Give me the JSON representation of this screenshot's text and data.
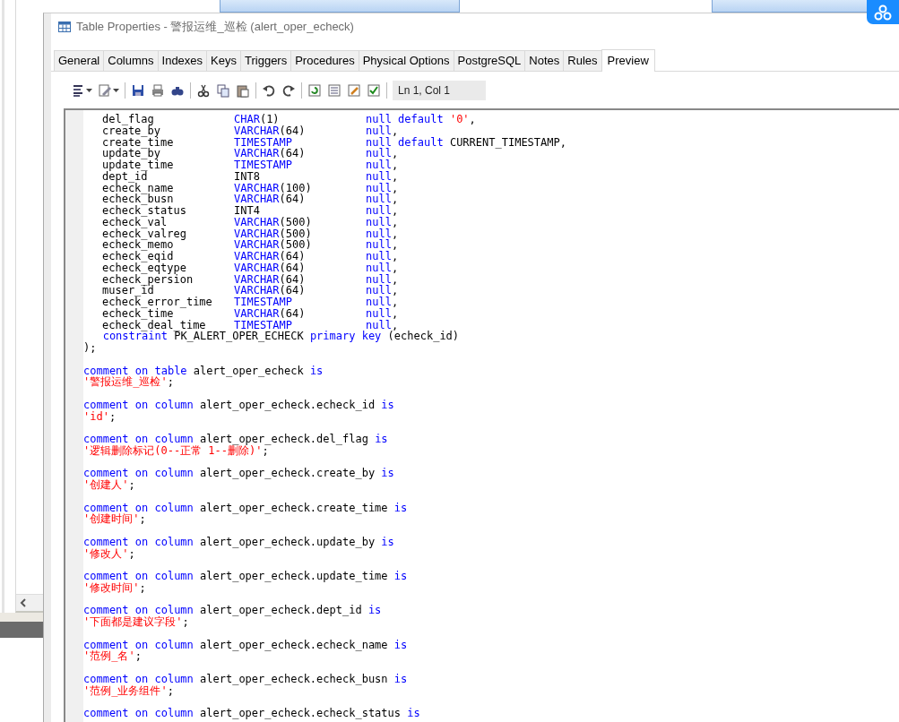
{
  "window": {
    "title": "Table Properties - 警报运维_巡检 (alert_oper_echeck)"
  },
  "tabs": [
    {
      "label": "General",
      "selected": false
    },
    {
      "label": "Columns",
      "selected": false
    },
    {
      "label": "Indexes",
      "selected": false
    },
    {
      "label": "Keys",
      "selected": false
    },
    {
      "label": "Triggers",
      "selected": false
    },
    {
      "label": "Procedures",
      "selected": false
    },
    {
      "label": "Physical Options",
      "selected": false
    },
    {
      "label": "PostgreSQL",
      "selected": false
    },
    {
      "label": "Notes",
      "selected": false
    },
    {
      "label": "Rules",
      "selected": false
    },
    {
      "label": "Preview",
      "selected": true
    }
  ],
  "toolbar": {
    "position": "Ln 1, Col 1"
  },
  "editor": {
    "columns": [
      {
        "name": "del_flag",
        "type": [
          {
            "kind": "keyword",
            "text": "CHAR"
          },
          {
            "kind": "plain",
            "text": "(1)"
          }
        ],
        "rest": [
          {
            "kind": "keyword",
            "text": "null default "
          },
          {
            "kind": "string",
            "text": "'0'"
          },
          {
            "kind": "plain",
            "text": ","
          }
        ]
      },
      {
        "name": "create_by",
        "type": [
          {
            "kind": "keyword",
            "text": "VARCHAR"
          },
          {
            "kind": "plain",
            "text": "(64)"
          }
        ],
        "rest": [
          {
            "kind": "keyword",
            "text": "null"
          },
          {
            "kind": "plain",
            "text": ","
          }
        ]
      },
      {
        "name": "create_time",
        "type": [
          {
            "kind": "keyword",
            "text": "TIMESTAMP"
          }
        ],
        "rest": [
          {
            "kind": "keyword",
            "text": "null default "
          },
          {
            "kind": "plain",
            "text": "CURRENT_TIMESTAMP,"
          }
        ]
      },
      {
        "name": "update_by",
        "type": [
          {
            "kind": "keyword",
            "text": "VARCHAR"
          },
          {
            "kind": "plain",
            "text": "(64)"
          }
        ],
        "rest": [
          {
            "kind": "keyword",
            "text": "null"
          },
          {
            "kind": "plain",
            "text": ","
          }
        ]
      },
      {
        "name": "update_time",
        "type": [
          {
            "kind": "keyword",
            "text": "TIMESTAMP"
          }
        ],
        "rest": [
          {
            "kind": "keyword",
            "text": "null"
          },
          {
            "kind": "plain",
            "text": ","
          }
        ]
      },
      {
        "name": "dept_id",
        "type": [
          {
            "kind": "plain",
            "text": "INT8"
          }
        ],
        "rest": [
          {
            "kind": "keyword",
            "text": "null"
          },
          {
            "kind": "plain",
            "text": ","
          }
        ]
      },
      {
        "name": "echeck_name",
        "type": [
          {
            "kind": "keyword",
            "text": "VARCHAR"
          },
          {
            "kind": "plain",
            "text": "(100)"
          }
        ],
        "rest": [
          {
            "kind": "keyword",
            "text": "null"
          },
          {
            "kind": "plain",
            "text": ","
          }
        ]
      },
      {
        "name": "echeck_busn",
        "type": [
          {
            "kind": "keyword",
            "text": "VARCHAR"
          },
          {
            "kind": "plain",
            "text": "(64)"
          }
        ],
        "rest": [
          {
            "kind": "keyword",
            "text": "null"
          },
          {
            "kind": "plain",
            "text": ","
          }
        ]
      },
      {
        "name": "echeck_status",
        "type": [
          {
            "kind": "plain",
            "text": "INT4"
          }
        ],
        "rest": [
          {
            "kind": "keyword",
            "text": "null"
          },
          {
            "kind": "plain",
            "text": ","
          }
        ]
      },
      {
        "name": "echeck_val",
        "type": [
          {
            "kind": "keyword",
            "text": "VARCHAR"
          },
          {
            "kind": "plain",
            "text": "(500)"
          }
        ],
        "rest": [
          {
            "kind": "keyword",
            "text": "null"
          },
          {
            "kind": "plain",
            "text": ","
          }
        ]
      },
      {
        "name": "echeck_valreg",
        "type": [
          {
            "kind": "keyword",
            "text": "VARCHAR"
          },
          {
            "kind": "plain",
            "text": "(500)"
          }
        ],
        "rest": [
          {
            "kind": "keyword",
            "text": "null"
          },
          {
            "kind": "plain",
            "text": ","
          }
        ]
      },
      {
        "name": "echeck_memo",
        "type": [
          {
            "kind": "keyword",
            "text": "VARCHAR"
          },
          {
            "kind": "plain",
            "text": "(500)"
          }
        ],
        "rest": [
          {
            "kind": "keyword",
            "text": "null"
          },
          {
            "kind": "plain",
            "text": ","
          }
        ]
      },
      {
        "name": "echeck_eqid",
        "type": [
          {
            "kind": "keyword",
            "text": "VARCHAR"
          },
          {
            "kind": "plain",
            "text": "(64)"
          }
        ],
        "rest": [
          {
            "kind": "keyword",
            "text": "null"
          },
          {
            "kind": "plain",
            "text": ","
          }
        ]
      },
      {
        "name": "echeck_eqtype",
        "type": [
          {
            "kind": "keyword",
            "text": "VARCHAR"
          },
          {
            "kind": "plain",
            "text": "(64)"
          }
        ],
        "rest": [
          {
            "kind": "keyword",
            "text": "null"
          },
          {
            "kind": "plain",
            "text": ","
          }
        ]
      },
      {
        "name": "echeck_persion",
        "type": [
          {
            "kind": "keyword",
            "text": "VARCHAR"
          },
          {
            "kind": "plain",
            "text": "(64)"
          }
        ],
        "rest": [
          {
            "kind": "keyword",
            "text": "null"
          },
          {
            "kind": "plain",
            "text": ","
          }
        ]
      },
      {
        "name": "muser_id",
        "type": [
          {
            "kind": "keyword",
            "text": "VARCHAR"
          },
          {
            "kind": "plain",
            "text": "(64)"
          }
        ],
        "rest": [
          {
            "kind": "keyword",
            "text": "null"
          },
          {
            "kind": "plain",
            "text": ","
          }
        ]
      },
      {
        "name": "echeck_error_time",
        "type": [
          {
            "kind": "keyword",
            "text": "TIMESTAMP"
          }
        ],
        "rest": [
          {
            "kind": "keyword",
            "text": "null"
          },
          {
            "kind": "plain",
            "text": ","
          }
        ]
      },
      {
        "name": "echeck_time",
        "type": [
          {
            "kind": "keyword",
            "text": "VARCHAR"
          },
          {
            "kind": "plain",
            "text": "(64)"
          }
        ],
        "rest": [
          {
            "kind": "keyword",
            "text": "null"
          },
          {
            "kind": "plain",
            "text": ","
          }
        ]
      },
      {
        "name": "echeck_deal_time",
        "type": [
          {
            "kind": "keyword",
            "text": "TIMESTAMP"
          }
        ],
        "rest": [
          {
            "kind": "keyword",
            "text": "null"
          },
          {
            "kind": "plain",
            "text": ","
          }
        ]
      }
    ],
    "tail": [
      [
        {
          "kind": "keyword",
          "text": "   constraint "
        },
        {
          "kind": "plain",
          "text": "PK_ALERT_OPER_ECHECK "
        },
        {
          "kind": "keyword",
          "text": "primary key "
        },
        {
          "kind": "plain",
          "text": "(echeck_id)"
        }
      ],
      [
        {
          "kind": "plain",
          "text": ");"
        }
      ]
    ],
    "comments": [
      {
        "head": [
          {
            "kind": "keyword",
            "text": "comment on table "
          },
          {
            "kind": "plain",
            "text": "alert_oper_echeck "
          },
          {
            "kind": "keyword",
            "text": "is"
          }
        ],
        "text": [
          {
            "kind": "string",
            "text": "'警报运维_巡检'"
          },
          {
            "kind": "plain",
            "text": ";"
          }
        ]
      },
      {
        "head": [
          {
            "kind": "keyword",
            "text": "comment on column "
          },
          {
            "kind": "plain",
            "text": "alert_oper_echeck.echeck_id "
          },
          {
            "kind": "keyword",
            "text": "is"
          }
        ],
        "text": [
          {
            "kind": "string",
            "text": "'id'"
          },
          {
            "kind": "plain",
            "text": ";"
          }
        ]
      },
      {
        "head": [
          {
            "kind": "keyword",
            "text": "comment on column "
          },
          {
            "kind": "plain",
            "text": "alert_oper_echeck.del_flag "
          },
          {
            "kind": "keyword",
            "text": "is"
          }
        ],
        "text": [
          {
            "kind": "string",
            "text": "'逻辑删除标记(0--正常 1--删除)'"
          },
          {
            "kind": "plain",
            "text": ";"
          }
        ]
      },
      {
        "head": [
          {
            "kind": "keyword",
            "text": "comment on column "
          },
          {
            "kind": "plain",
            "text": "alert_oper_echeck.create_by "
          },
          {
            "kind": "keyword",
            "text": "is"
          }
        ],
        "text": [
          {
            "kind": "string",
            "text": "'创建人'"
          },
          {
            "kind": "plain",
            "text": ";"
          }
        ]
      },
      {
        "head": [
          {
            "kind": "keyword",
            "text": "comment on column "
          },
          {
            "kind": "plain",
            "text": "alert_oper_echeck.create_time "
          },
          {
            "kind": "keyword",
            "text": "is"
          }
        ],
        "text": [
          {
            "kind": "string",
            "text": "'创建时间'"
          },
          {
            "kind": "plain",
            "text": ";"
          }
        ]
      },
      {
        "head": [
          {
            "kind": "keyword",
            "text": "comment on column "
          },
          {
            "kind": "plain",
            "text": "alert_oper_echeck.update_by "
          },
          {
            "kind": "keyword",
            "text": "is"
          }
        ],
        "text": [
          {
            "kind": "string",
            "text": "'修改人'"
          },
          {
            "kind": "plain",
            "text": ";"
          }
        ]
      },
      {
        "head": [
          {
            "kind": "keyword",
            "text": "comment on column "
          },
          {
            "kind": "plain",
            "text": "alert_oper_echeck.update_time "
          },
          {
            "kind": "keyword",
            "text": "is"
          }
        ],
        "text": [
          {
            "kind": "string",
            "text": "'修改时间'"
          },
          {
            "kind": "plain",
            "text": ";"
          }
        ]
      },
      {
        "head": [
          {
            "kind": "keyword",
            "text": "comment on column "
          },
          {
            "kind": "plain",
            "text": "alert_oper_echeck.dept_id "
          },
          {
            "kind": "keyword",
            "text": "is"
          }
        ],
        "text": [
          {
            "kind": "string",
            "text": "'下面都是建议字段'"
          },
          {
            "kind": "plain",
            "text": ";"
          }
        ]
      },
      {
        "head": [
          {
            "kind": "keyword",
            "text": "comment on column "
          },
          {
            "kind": "plain",
            "text": "alert_oper_echeck.echeck_name "
          },
          {
            "kind": "keyword",
            "text": "is"
          }
        ],
        "text": [
          {
            "kind": "string",
            "text": "'范例_名'"
          },
          {
            "kind": "plain",
            "text": ";"
          }
        ]
      },
      {
        "head": [
          {
            "kind": "keyword",
            "text": "comment on column "
          },
          {
            "kind": "plain",
            "text": "alert_oper_echeck.echeck_busn "
          },
          {
            "kind": "keyword",
            "text": "is"
          }
        ],
        "text": [
          {
            "kind": "string",
            "text": "'范例_业务组件'"
          },
          {
            "kind": "plain",
            "text": ";"
          }
        ]
      },
      {
        "head": [
          {
            "kind": "keyword",
            "text": "comment on column "
          },
          {
            "kind": "plain",
            "text": "alert_oper_echeck.echeck_status "
          },
          {
            "kind": "keyword",
            "text": "is"
          }
        ]
      }
    ]
  }
}
